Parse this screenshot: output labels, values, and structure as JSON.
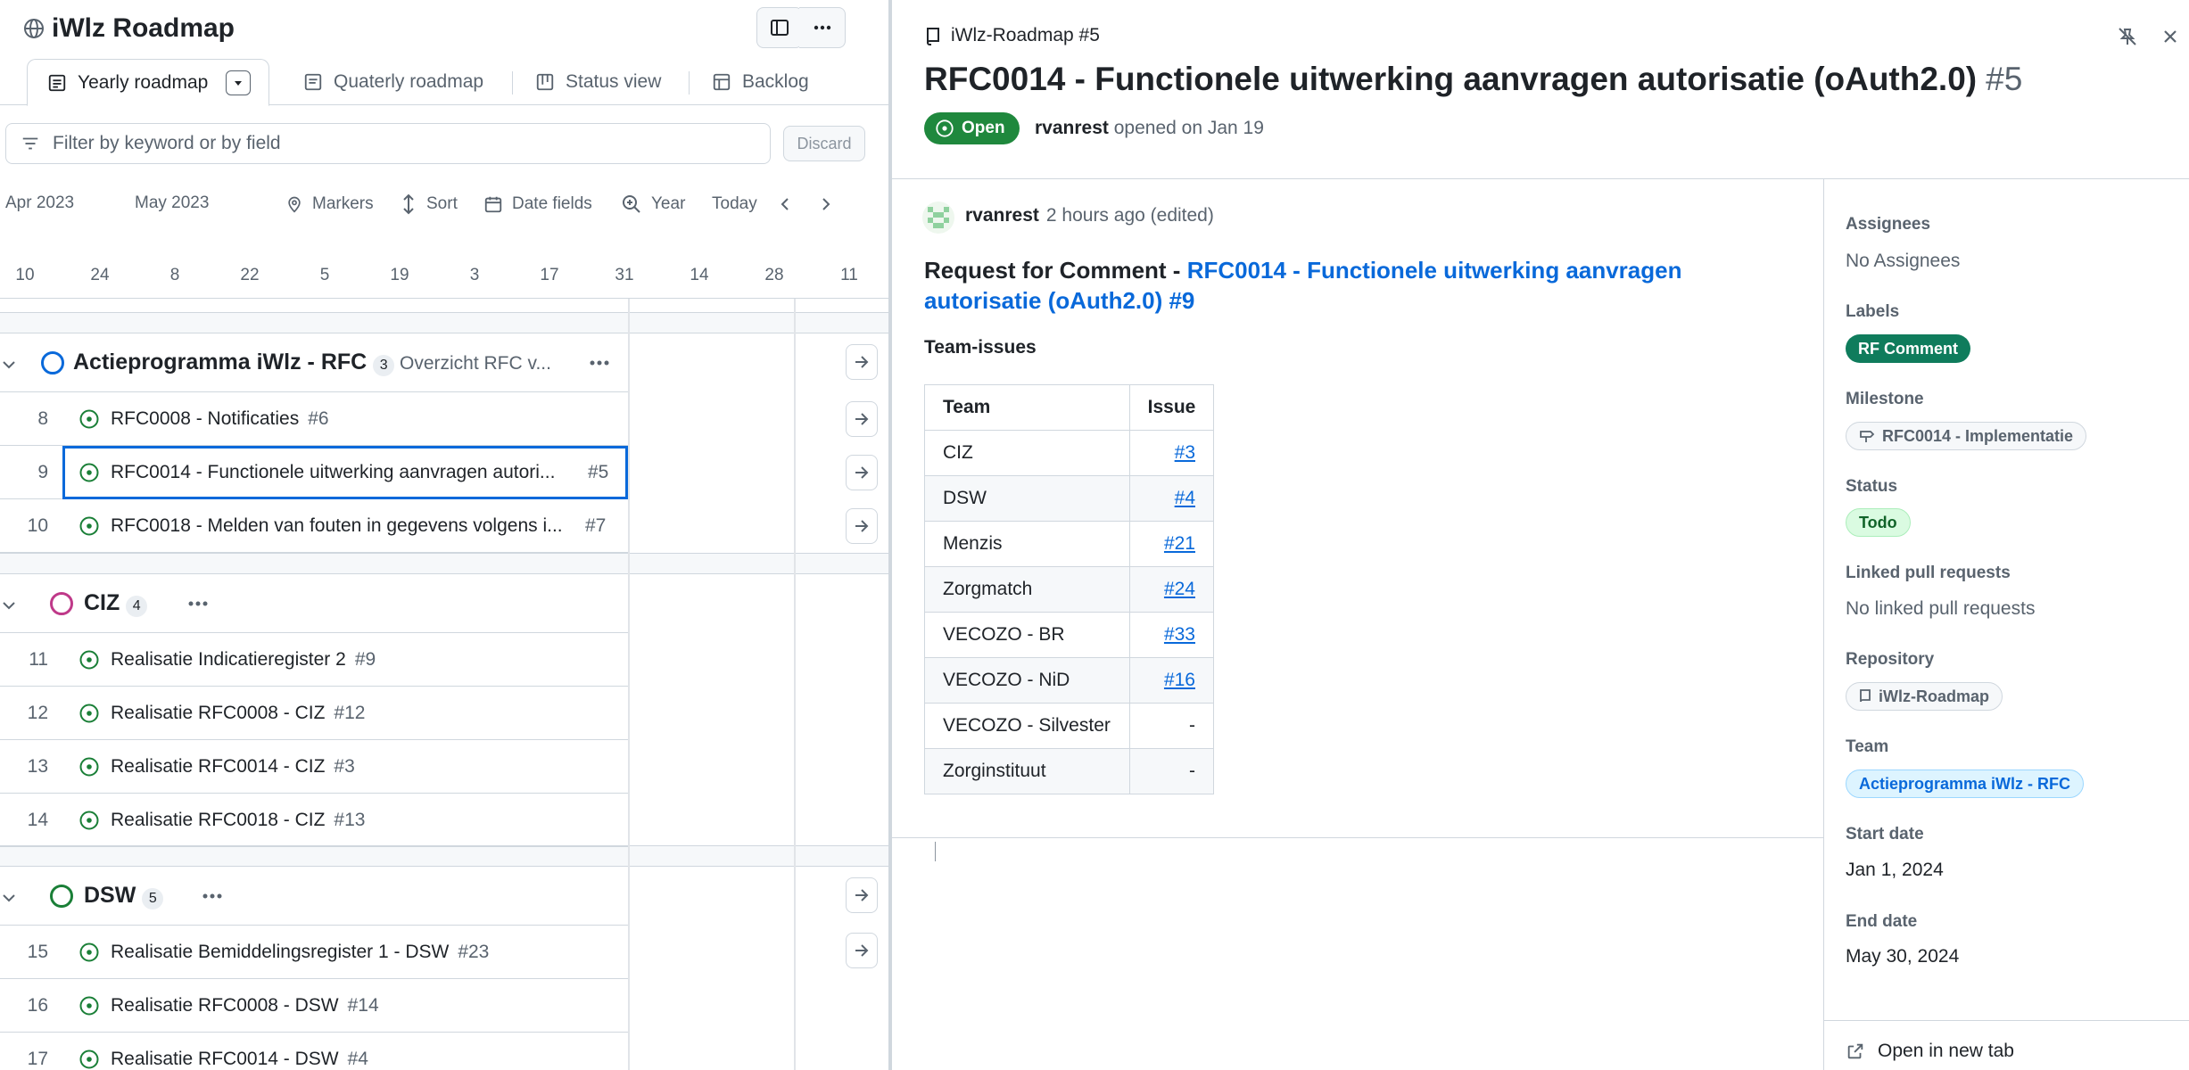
{
  "project": {
    "title": "iWlz Roadmap",
    "icons": {
      "globe": "globe-icon",
      "layout": "sidebar-toggle-icon",
      "more": "kebab-horizontal-icon"
    }
  },
  "tabs": [
    {
      "label": "Yearly roadmap",
      "active": true
    },
    {
      "label": "Quaterly roadmap"
    },
    {
      "label": "Status view"
    },
    {
      "label": "Backlog"
    }
  ],
  "filter": {
    "placeholder": "Filter by keyword or by field",
    "discard_label": "Discard"
  },
  "timeline": {
    "months": [
      "Apr 2023",
      "May 2023"
    ],
    "toolbar": {
      "markers": "Markers",
      "sort": "Sort",
      "date_fields": "Date fields",
      "zoom": "Year",
      "today": "Today"
    },
    "days": [
      "10",
      "24",
      "8",
      "22",
      "5",
      "19",
      "3",
      "17",
      "31",
      "14",
      "28",
      "11"
    ]
  },
  "groups": [
    {
      "name": "Actieprogramma iWlz - RFC",
      "count": "3",
      "description": "Overzicht RFC v...",
      "color": "#0969da",
      "rows": [
        {
          "num": "8",
          "title": "RFC0008 - Notificaties",
          "issue": "#6"
        },
        {
          "num": "9",
          "title": "RFC0014 - Functionele uitwerking aanvragen autori...",
          "issue": "#5",
          "selected": true
        },
        {
          "num": "10",
          "title": "RFC0018 - Melden van fouten in gegevens volgens i...",
          "issue": "#7"
        }
      ]
    },
    {
      "name": "CIZ",
      "count": "4",
      "color": "#bf3989",
      "rows": [
        {
          "num": "11",
          "title": "Realisatie Indicatieregister 2",
          "issue": "#9"
        },
        {
          "num": "12",
          "title": "Realisatie RFC0008 - CIZ",
          "issue": "#12"
        },
        {
          "num": "13",
          "title": "Realisatie RFC0014 - CIZ",
          "issue": "#3"
        },
        {
          "num": "14",
          "title": "Realisatie RFC0018 - CIZ",
          "issue": "#13"
        }
      ]
    },
    {
      "name": "DSW",
      "count": "5",
      "color": "#1a7f37",
      "rows": [
        {
          "num": "15",
          "title": "Realisatie Bemiddelingsregister 1 - DSW",
          "issue": "#23"
        },
        {
          "num": "16",
          "title": "Realisatie RFC0008 - DSW",
          "issue": "#14"
        },
        {
          "num": "17",
          "title": "Realisatie RFC0014 - DSW",
          "issue": "#4"
        }
      ]
    }
  ],
  "issue": {
    "repo_ref": "iWlz-Roadmap #5",
    "title": "RFC0014 - Functionele uitwerking aanvragen autorisatie (oAuth2.0)",
    "number": "#5",
    "state": "Open",
    "author": "rvanrest",
    "opened_text": "opened on Jan 19",
    "comment": {
      "author": "rvanrest",
      "time": "2 hours ago (edited)",
      "heading_prefix": "Request for Comment - ",
      "heading_link": "RFC0014 - Functionele uitwerking aanvragen autorisatie (oAuth2.0) #9",
      "subheading": "Team-issues",
      "table": {
        "headers": [
          "Team",
          "Issue"
        ],
        "rows": [
          [
            "CIZ",
            "#3"
          ],
          [
            "DSW",
            "#4"
          ],
          [
            "Menzis",
            "#21"
          ],
          [
            "Zorgmatch",
            "#24"
          ],
          [
            "VECOZO - BR",
            "#33"
          ],
          [
            "VECOZO - NiD",
            "#16"
          ],
          [
            "VECOZO - Silvester",
            "-"
          ],
          [
            "Zorginstituut",
            "-"
          ]
        ]
      }
    }
  },
  "sidebar": {
    "assignees_label": "Assignees",
    "assignees_value": "No Assignees",
    "labels_label": "Labels",
    "label_value": "RF Comment",
    "label_color": "#0f7c5c",
    "milestone_label": "Milestone",
    "milestone_value": "RFC0014 - Implementatie",
    "status_label": "Status",
    "status_value": "Todo",
    "linked_label": "Linked pull requests",
    "linked_value": "No linked pull requests",
    "repository_label": "Repository",
    "repository_value": "iWlz-Roadmap",
    "team_label": "Team",
    "team_value": "Actieprogramma iWlz - RFC",
    "start_label": "Start date",
    "start_value": "Jan 1, 2024",
    "end_label": "End date",
    "end_value": "May 30, 2024",
    "open_new_tab": "Open in new tab"
  }
}
